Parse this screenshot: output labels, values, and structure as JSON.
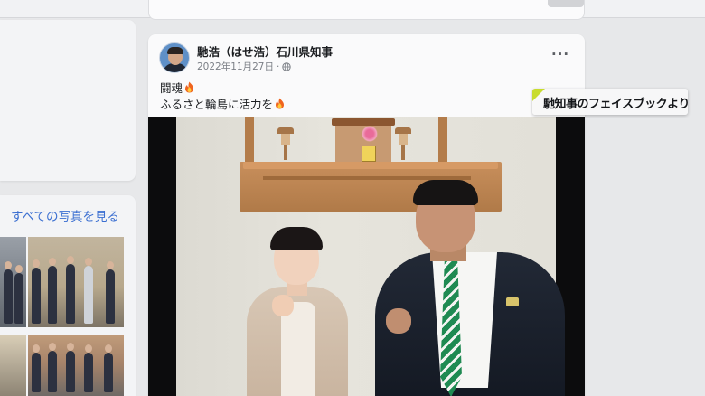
{
  "post": {
    "author": "馳浩（はせ浩）石川県知事",
    "date": "2022年11月27日",
    "separator": "·",
    "more_label": "···",
    "line1": "闘魂",
    "line2": "ふるさと輪島に活力を",
    "icons": {
      "privacy": "globe-icon",
      "emoji": "fire-emoji",
      "menu": "more-options-icon"
    }
  },
  "sidebar": {
    "photos_link": "すべての写真を見る"
  },
  "overlay": {
    "caption": "馳知事のフェイスブックより",
    "accent_color": "#c8dc2e"
  }
}
